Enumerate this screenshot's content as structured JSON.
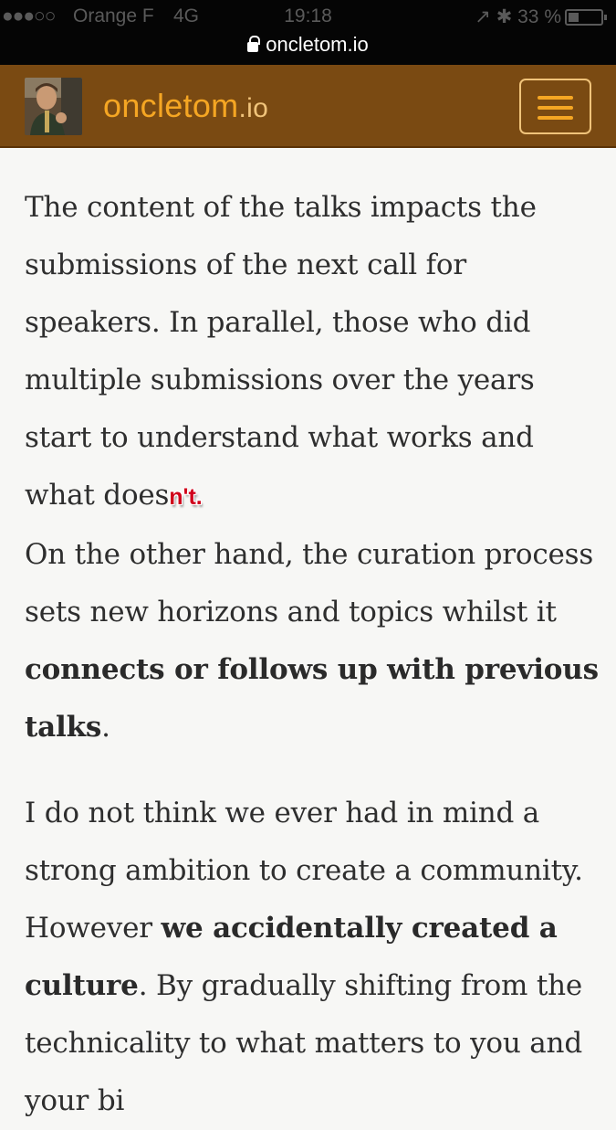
{
  "status_bar": {
    "signal": "●●●○○",
    "carrier": "Orange F",
    "network": "4G",
    "time": "19:18",
    "right": "↗ ✱ 33 %"
  },
  "url_bar": {
    "domain": "oncletom.io"
  },
  "header": {
    "logo_main": "oncletom",
    "logo_tld": ".io",
    "accent_color": "#f5a623",
    "background_color": "#7a4a12"
  },
  "article": {
    "p1": {
      "lines": [
        "The content of the talks impacts the submissions of the next call for speakers. In parallel, those who did multiple submissions over the years start to understand what works and what does",
        "n't.",
        "On the other hand, the curation process sets new horizons and topics whilst it ",
        "connects or follows up with previous talks",
        "."
      ]
    },
    "p2": {
      "lines": [
        "I do not think we ever had in mind a strong ambition to create a community. However ",
        "we accidentally created a culture",
        ". By gradually shifting from the technicality to what matters to you and your bi"
      ]
    }
  }
}
